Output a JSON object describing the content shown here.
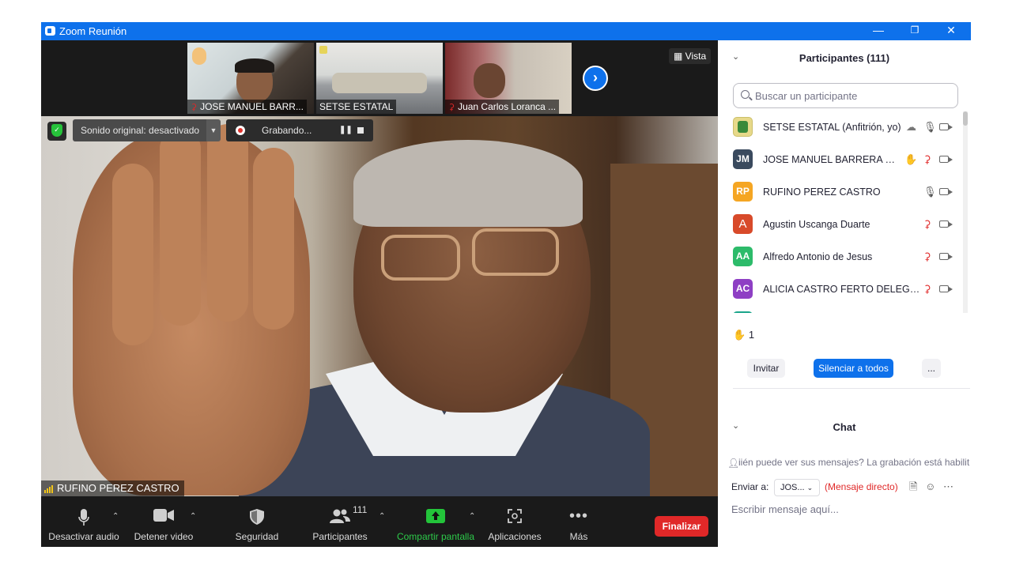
{
  "window": {
    "title": "Zoom Reunión"
  },
  "video": {
    "thumbnails": [
      {
        "name": "JOSE MANUEL BARR...",
        "muted": true
      },
      {
        "name": "SETSE ESTATAL",
        "muted": false
      },
      {
        "name": "Juan Carlos Loranca ...",
        "muted": true
      }
    ],
    "view_label": "Vista",
    "audio_status": "Sonido original: desactivado",
    "recording_label": "Grabando...",
    "active_speaker": "RUFINO PEREZ CASTRO"
  },
  "toolbar": {
    "mute_label": "Desactivar audio",
    "video_label": "Detener video",
    "security_label": "Seguridad",
    "participants_label": "Participantes",
    "participants_count": "111",
    "share_label": "Compartir pantalla",
    "apps_label": "Aplicaciones",
    "more_label": "Más",
    "end_label": "Finalizar"
  },
  "participants": {
    "title": "Participantes (111)",
    "search_placeholder": "Buscar un participante",
    "list": [
      {
        "initials": "",
        "name": "SETSE ESTATAL (Anfitrión, yo)",
        "color": "#e7d98a",
        "mic": "on",
        "cloud": true
      },
      {
        "initials": "JM",
        "name": "JOSE MANUEL BARRERA L...",
        "color": "#3a4a5e",
        "mic": "off",
        "hand": true
      },
      {
        "initials": "RP",
        "name": "RUFINO PEREZ CASTRO",
        "color": "#f5a623",
        "mic": "on"
      },
      {
        "initials": "A",
        "name": "Agustin Uscanga Duarte",
        "color": "#d84a2a",
        "mic": "off"
      },
      {
        "initials": "AA",
        "name": "Alfredo Antonio de Jesus",
        "color": "#2dbb6a",
        "mic": "off"
      },
      {
        "initials": "AC",
        "name": "ALICIA CASTRO FERTO DELEGAC...",
        "color": "#8e3fc4",
        "mic": "off"
      }
    ],
    "raised_hands": "1",
    "invite_label": "Invitar",
    "mute_all_label": "Silenciar a todos",
    "more_label": "..."
  },
  "chat": {
    "title": "Chat",
    "info": "iién puede ver sus mensajes? La grabación está habilit",
    "send_to_label": "Enviar a:",
    "recipient": "JOS...",
    "direct_message": "(Mensaje directo)",
    "input_placeholder": "Escribir mensaje aquí..."
  }
}
